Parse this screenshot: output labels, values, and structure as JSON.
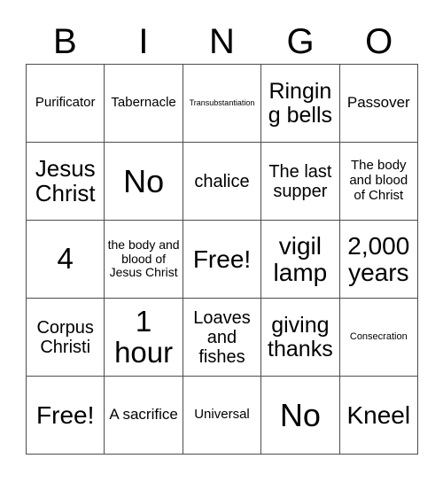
{
  "card": {
    "header_letters": [
      "B",
      "I",
      "N",
      "G",
      "O"
    ],
    "columns": 5,
    "rows": 5,
    "colors": {
      "background": "#ffffff",
      "text": "#000000",
      "grid_line": "#4d4d4d"
    },
    "cells": [
      [
        {
          "text": "Purificator",
          "size": "fs-sm"
        },
        {
          "text": "Tabernacle",
          "size": "fs-sm"
        },
        {
          "text": "Transubstantiation",
          "size": "fs-xxs"
        },
        {
          "text": "Ringing bells",
          "size": "fs-l"
        },
        {
          "text": "Passover",
          "size": "fs-m"
        }
      ],
      [
        {
          "text": "Jesus Christ",
          "size": "fs-xl"
        },
        {
          "text": "No",
          "size": "fs-4xl"
        },
        {
          "text": "chalice",
          "size": "fs-ml"
        },
        {
          "text": "The last supper",
          "size": "fs-ml"
        },
        {
          "text": "The body and blood of Christ",
          "size": "fs-sm"
        }
      ],
      [
        {
          "text": "4",
          "size": "fs-3xl"
        },
        {
          "text": "the body and blood of Jesus Christ",
          "size": "fs-s"
        },
        {
          "text": "Free!",
          "size": "fs-xxl"
        },
        {
          "text": "vigil lamp",
          "size": "fs-xxl"
        },
        {
          "text": "2,000 years",
          "size": "fs-xxl"
        }
      ],
      [
        {
          "text": "Corpus Christi",
          "size": "fs-ml"
        },
        {
          "text": "1 hour",
          "size": "fs-3xl"
        },
        {
          "text": "Loaves and fishes",
          "size": "fs-ml"
        },
        {
          "text": "giving thanks",
          "size": "fs-l"
        },
        {
          "text": "Consecration",
          "size": "fs-xs"
        }
      ],
      [
        {
          "text": "Free!",
          "size": "fs-xxl"
        },
        {
          "text": "A sacrifice",
          "size": "fs-m"
        },
        {
          "text": "Universal",
          "size": "fs-sm"
        },
        {
          "text": "No",
          "size": "fs-4xl"
        },
        {
          "text": "Kneel",
          "size": "fs-xxl"
        }
      ]
    ]
  }
}
